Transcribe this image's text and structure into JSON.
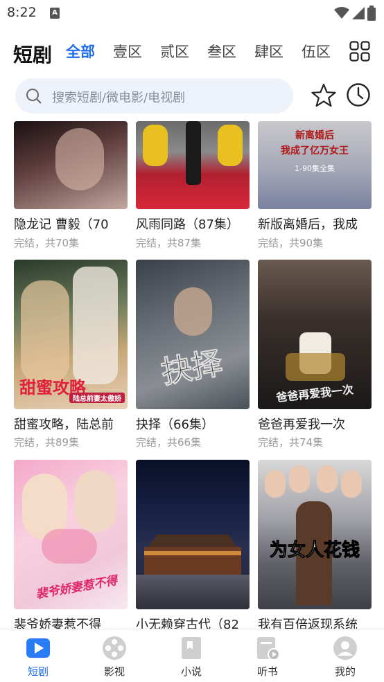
{
  "status_bar": {
    "time": "8:22",
    "notify_glyph": "A"
  },
  "header": {
    "title": "短剧",
    "tabs": [
      {
        "label": "全部",
        "active": true
      },
      {
        "label": "壹区"
      },
      {
        "label": "贰区"
      },
      {
        "label": "叁区"
      },
      {
        "label": "肆区"
      },
      {
        "label": "伍区"
      }
    ]
  },
  "search": {
    "placeholder": "搜索短剧/微电影/电视剧"
  },
  "icons": {
    "grid": "grid-icon",
    "star": "star-icon",
    "history": "clock-icon",
    "search": "search-icon"
  },
  "colors": {
    "accent": "#1e6cf0",
    "search_bg": "#eef2fa",
    "subtitle": "#999999",
    "nav_inactive": "#cccccc"
  },
  "cards": [
    {
      "title": "隐龙记 曹毅（70",
      "subtitle": "完结，共70集"
    },
    {
      "title": "风雨同路（87集）",
      "subtitle": "完结，共87集"
    },
    {
      "title": "新版离婚后，我成",
      "subtitle": "完结，共90集",
      "poster_text": [
        "新离婚后",
        "我成了亿万女王",
        "1-90集全集"
      ]
    },
    {
      "title": "甜蜜攻略，陆总前",
      "subtitle": "完结，共89集",
      "poster_text": [
        "甜蜜攻略",
        "陆总前妻太傲娇"
      ]
    },
    {
      "title": "抉择（66集）",
      "subtitle": "完结，共66集",
      "poster_text": [
        "抉择"
      ]
    },
    {
      "title": "爸爸再爱我一次",
      "subtitle": "完结，共74集",
      "poster_text": [
        "爸爸再爱我一次"
      ]
    },
    {
      "title": "裴爷娇妻惹不得",
      "subtitle": "",
      "poster_text": [
        "裴爷娇妻惹不得"
      ]
    },
    {
      "title": "小无赖穿古代（82",
      "subtitle": ""
    },
    {
      "title": "我有百倍返现系统",
      "subtitle": "",
      "poster_text": [
        "为女人花钱"
      ]
    }
  ],
  "bottom_nav": [
    {
      "label": "短剧",
      "icon": "play-icon",
      "active": true
    },
    {
      "label": "影视",
      "icon": "film-reel-icon"
    },
    {
      "label": "小说",
      "icon": "book-icon"
    },
    {
      "label": "听书",
      "icon": "audiobook-icon"
    },
    {
      "label": "我的",
      "icon": "profile-icon"
    }
  ]
}
